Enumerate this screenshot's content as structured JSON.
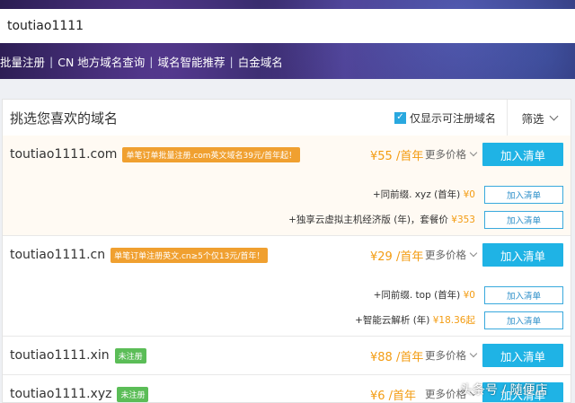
{
  "search": {
    "value": "toutiao1111"
  },
  "quick_links": [
    "批量注册",
    "CN 地方域名查询",
    "域名智能推荐",
    "白金域名"
  ],
  "quick_link_separator": "|",
  "panel": {
    "title": "挑选您喜欢的域名",
    "only_available_label": "仅显示可注册域名",
    "filter_label": "筛选"
  },
  "results": [
    {
      "domain": "toutiao1111.com",
      "tag": "单笔订单批量注册.com英文域名39元/首年起！",
      "tag_color": "#f0a030",
      "price": "¥55 /首年",
      "more": "更多价格",
      "add": "加入清单",
      "addons": [
        {
          "text": "+同前缀. xyz (首年)",
          "price": "¥0",
          "button": "加入清单"
        },
        {
          "text": "+独享云虚拟主机经济版 (年)，套餐价",
          "price": "¥353",
          "button": "加入清单"
        }
      ]
    },
    {
      "domain": "toutiao1111.cn",
      "tag": "单笔订单注册英文.cn≥5个仅13元/首年！",
      "tag_color": "#f0a030",
      "price": "¥29 /首年",
      "more": "更多价格",
      "add": "加入清单",
      "addons": [
        {
          "text": "+同前缀. top (首年)",
          "price": "¥0",
          "button": "加入清单"
        },
        {
          "text": "+智能云解析 (年)",
          "price": "¥18.36起",
          "button": "加入清单"
        }
      ]
    },
    {
      "domain": "toutiao1111.xin",
      "tag": "未注册",
      "tag_color": "#5bbd57",
      "price": "¥88 /首年",
      "more": "更多价格",
      "add": "加入清单",
      "addons": []
    },
    {
      "domain": "toutiao1111.xyz",
      "tag": "未注册",
      "tag_color": "#5bbd57",
      "price": "¥6 /首年",
      "more": "更多价格",
      "add": "加入清单",
      "addons": []
    }
  ],
  "watermark": "头条号 / 随便店",
  "colors": {
    "accent": "#1fb3e5",
    "price": "#f39c12",
    "promo_tag": "#f0a030",
    "status_tag": "#5bbd57"
  }
}
